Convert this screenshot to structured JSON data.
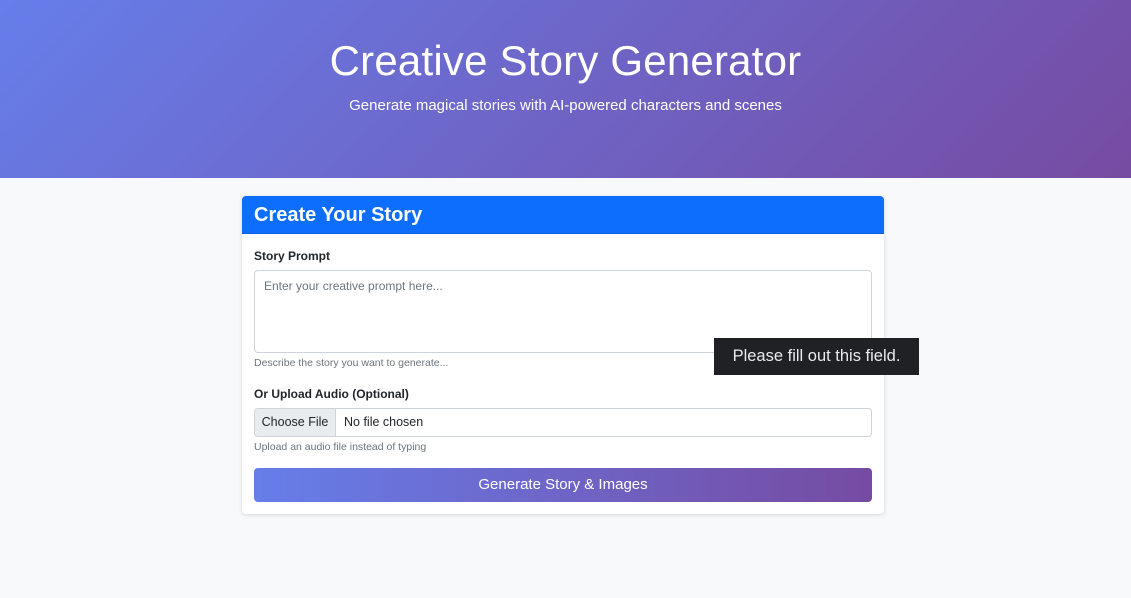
{
  "hero": {
    "title": "Creative Story Generator",
    "subtitle": "Generate magical stories with AI-powered characters and scenes",
    "gradient_start": "#667eea",
    "gradient_end": "#764ba2"
  },
  "card": {
    "header": "Create Your Story",
    "header_color": "#0d6efd",
    "prompt": {
      "label": "Story Prompt",
      "placeholder": "Enter your creative prompt here...",
      "value": "",
      "help": "Describe the story you want to generate..."
    },
    "audio": {
      "label": "Or Upload Audio (Optional)",
      "button_label": "Choose File",
      "status": "No file chosen",
      "help": "Upload an audio file instead of typing"
    },
    "submit_label": "Generate Story & Images"
  },
  "validation_tooltip": {
    "text": "Please fill out this field."
  }
}
